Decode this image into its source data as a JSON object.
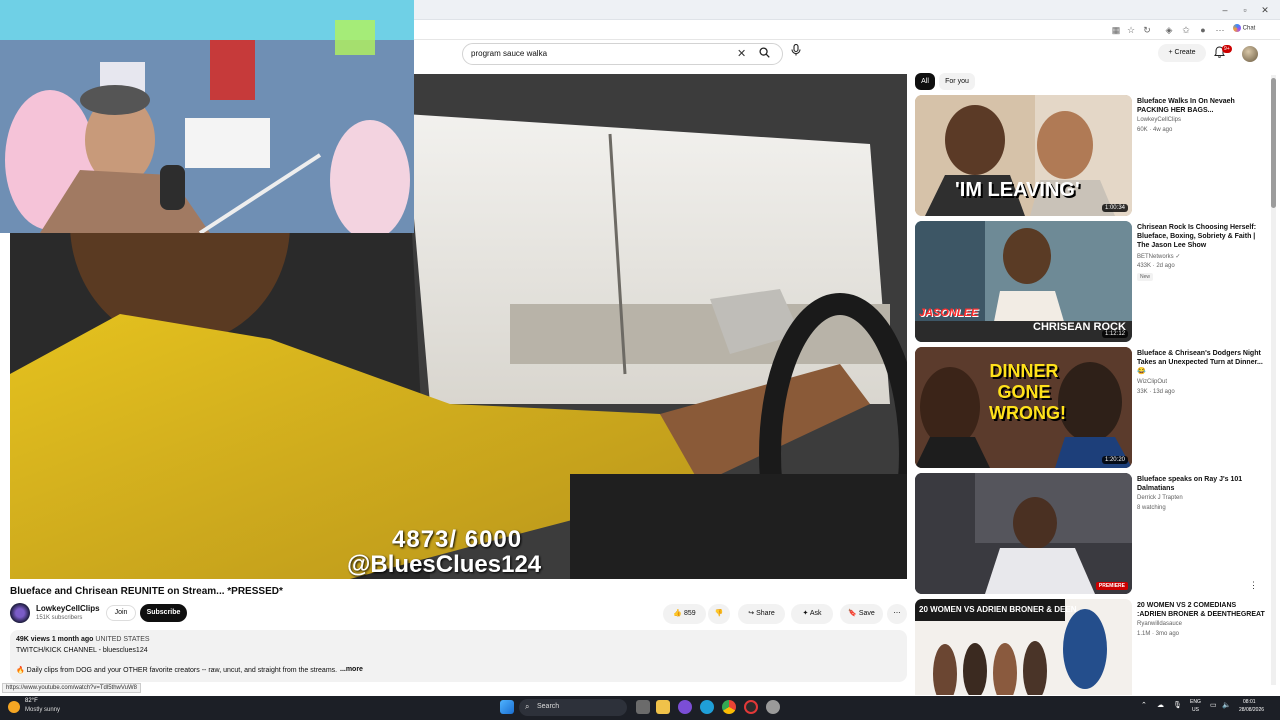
{
  "search": {
    "query": "program sauce walka"
  },
  "header": {
    "create_label": "Create",
    "notif_count": "9+",
    "chat_label": "Chat"
  },
  "video": {
    "overlay_count": "4873/ 6000",
    "overlay_handle": "@BluesClues124",
    "title": "Blueface and Chrisean REUNITE on Stream... *PRESSED*",
    "channel": "LowkeyCellClips",
    "subscribers": "151K subscribers",
    "join_label": "Join",
    "subscribe_label": "Subscribe",
    "likes": "859",
    "share_label": "Share",
    "ask_label": "Ask",
    "save_label": "Save",
    "desc_views": "49K views",
    "desc_date": "1 month ago",
    "desc_location": "UNITED STATES",
    "desc_line2": "TWITCH/KICK CHANNEL - bluesclues124",
    "desc_line3": "🔥 Daily clips from DOG and your OTHER favorite creators -- raw, uncut, and straight from the streams.",
    "desc_more": "...more",
    "status_url": "https://www.youtube.com/watch?v=Tdl5thwVuW8"
  },
  "chips": [
    {
      "label": "All"
    },
    {
      "label": "For you"
    }
  ],
  "recommendations": [
    {
      "title": "Blueface Walks In On Nevaeh PACKING HER BAGS...",
      "channel": "LowkeyCellClips",
      "meta": "60K · 4w ago",
      "duration": "1:00:34",
      "thumb_text": "'IM LEAVING'"
    },
    {
      "title": "Chrisean Rock Is Choosing Herself: Blueface, Boxing, Sobriety & Faith | The Jason Lee Show",
      "channel": "BETNetworks ✓",
      "meta": "433K · 2d ago",
      "badge": "New",
      "duration": "1:12:12",
      "thumb_text": "CHRISEAN ROCK",
      "thumb_text2": "JASONLEE"
    },
    {
      "title": "Blueface & Chrisean's Dodgers Night Takes an Unexpected Turn at Dinner... 😂",
      "channel": "WizClipOut",
      "meta": "33K · 13d ago",
      "duration": "1:20:20",
      "thumb_text": "DINNER GONE WRONG!"
    },
    {
      "title": "Blueface speaks on Ray J's 101 Dalmatians",
      "channel": "Derrick J Trapten",
      "meta": "8 watching",
      "duration": "PREMIERE",
      "thumb_text": ""
    },
    {
      "title": "20 WOMEN VS 2 COMEDIANS :ADRIEN BRONER & DEENTHEGREAT",
      "channel": "Ryanwilldasauce",
      "meta": "1.1M · 3mo ago",
      "duration": "",
      "thumb_text": "20 WOMEN VS ADRIEN BRONER & DEEN"
    }
  ],
  "taskbar": {
    "temp": "82°F",
    "weather": "Mostly sunny",
    "search_placeholder": "Search",
    "lang1": "ENG",
    "lang2": "US",
    "time": "08:01",
    "date": "28/08/2026"
  }
}
